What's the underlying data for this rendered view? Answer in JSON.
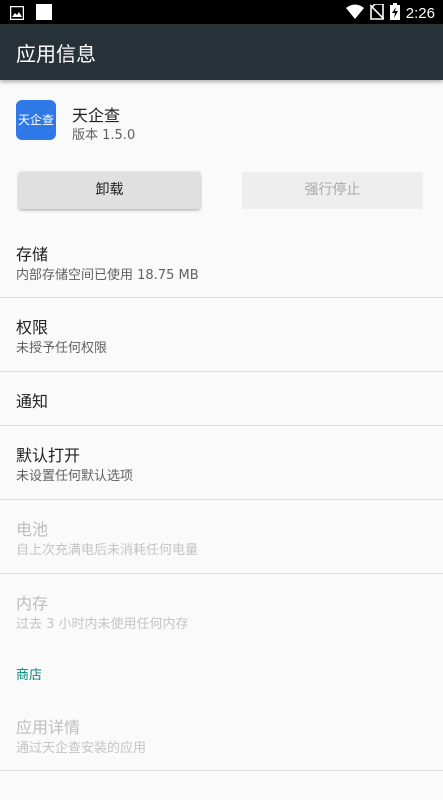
{
  "status_bar": {
    "time": "2:26",
    "left_icons": [
      "image-icon",
      "square-icon"
    ],
    "right_icons": [
      "wifi-icon",
      "no-sim-icon",
      "battery-charging-icon"
    ]
  },
  "app_bar": {
    "title": "应用信息"
  },
  "app": {
    "icon_text": "天企查",
    "name": "天企查",
    "version": "版本 1.5.0",
    "icon_color": "#2f78e8"
  },
  "buttons": {
    "uninstall": "卸载",
    "force_stop": "强行停止"
  },
  "settings": {
    "storage": {
      "title": "存储",
      "subtitle": "内部存储空间已使用 18.75 MB"
    },
    "permissions": {
      "title": "权限",
      "subtitle": "未授予任何权限"
    },
    "notifications": {
      "title": "通知"
    },
    "open_by_default": {
      "title": "默认打开",
      "subtitle": "未设置任何默认选项"
    },
    "battery": {
      "title": "电池",
      "subtitle": "自上次充满电后未消耗任何电量"
    },
    "memory": {
      "title": "内存",
      "subtitle": "过去 3 小时内未使用任何内存"
    },
    "store_category": "商店",
    "app_details": {
      "title": "应用详情",
      "subtitle": "通过天企查安装的应用"
    }
  },
  "colors": {
    "app_bar": "#263238",
    "accent": "#00897b",
    "background": "#fafafa"
  }
}
